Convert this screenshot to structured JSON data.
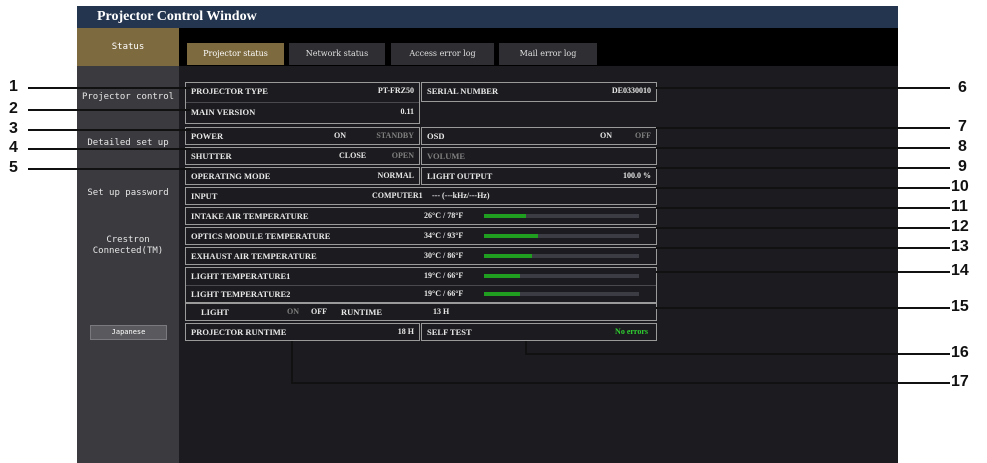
{
  "window": {
    "title": "Projector Control Window"
  },
  "sidebar": {
    "items": [
      {
        "label": "Status"
      },
      {
        "label": "Projector control"
      },
      {
        "label": "Detailed set up"
      },
      {
        "label": "Set up password"
      },
      {
        "label": "Crestron Connected(TM)"
      }
    ],
    "language_button": "Japanese"
  },
  "tabs": [
    {
      "label": "Projector status"
    },
    {
      "label": "Network status"
    },
    {
      "label": "Access error log"
    },
    {
      "label": "Mail error log"
    }
  ],
  "status": {
    "projector_type": {
      "label": "PROJECTOR TYPE",
      "value": "PT-FRZ50"
    },
    "serial_number": {
      "label": "SERIAL NUMBER",
      "value": "DE0330010"
    },
    "main_version": {
      "label": "MAIN VERSION",
      "value": "0.11"
    },
    "power": {
      "label": "POWER",
      "on": "ON",
      "standby": "STANDBY"
    },
    "osd": {
      "label": "OSD",
      "on": "ON",
      "off": "OFF"
    },
    "shutter": {
      "label": "SHUTTER",
      "close": "CLOSE",
      "open": "OPEN"
    },
    "volume": {
      "label": "VOLUME"
    },
    "operating_mode": {
      "label": "OPERATING MODE",
      "value": "NORMAL"
    },
    "light_output": {
      "label": "LIGHT OUTPUT",
      "value": "100.0 %"
    },
    "input": {
      "label": "INPUT",
      "value": "COMPUTER1",
      "detail": "--- (---kHz/---Hz)"
    },
    "temperatures": [
      {
        "label": "INTAKE AIR TEMPERATURE",
        "value": "26°C / 78°F",
        "level": 0.27
      },
      {
        "label": "OPTICS MODULE TEMPERATURE",
        "value": "34°C / 93°F",
        "level": 0.35
      },
      {
        "label": "EXHAUST AIR TEMPERATURE",
        "value": "30°C / 86°F",
        "level": 0.31
      },
      {
        "label": "LIGHT TEMPERATURE1",
        "value": "19°C / 66°F",
        "level": 0.23
      },
      {
        "label": "LIGHT TEMPERATURE2",
        "value": "19°C / 66°F",
        "level": 0.23
      }
    ],
    "light": {
      "label": "LIGHT",
      "on": "ON",
      "off": "OFF",
      "runtime_label": "RUNTIME",
      "runtime_value": "13 H"
    },
    "projector_runtime": {
      "label": "PROJECTOR RUNTIME",
      "value": "18 H"
    },
    "self_test": {
      "label": "SELF TEST",
      "value": "No errors"
    }
  },
  "callouts": [
    "1",
    "2",
    "3",
    "4",
    "5",
    "6",
    "7",
    "8",
    "9",
    "10",
    "11",
    "12",
    "13",
    "14",
    "15",
    "16",
    "17"
  ],
  "colors": {
    "active_tab": "#7d6a3f",
    "bar": "#1f9e1f",
    "ok_text": "#2fcf30",
    "title_bar": "#24354f"
  }
}
